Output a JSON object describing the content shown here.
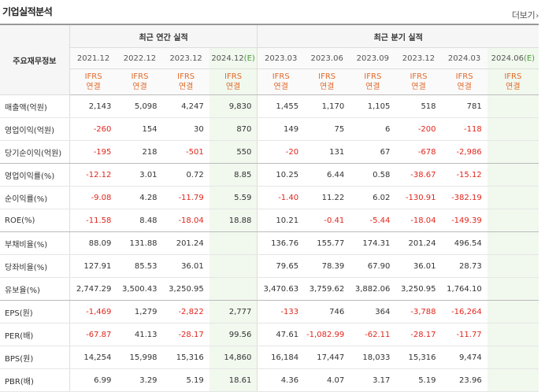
{
  "header": {
    "title": "기업실적분석",
    "more_label": "더보기",
    "more_icon": "chevron-right-icon"
  },
  "table": {
    "label_header": "주요재무정보",
    "groups": {
      "annual": "최근 연간 실적",
      "quarterly": "최근 분기 실적"
    },
    "periods": [
      {
        "label": "2021.12",
        "est": false
      },
      {
        "label": "2022.12",
        "est": false
      },
      {
        "label": "2023.12",
        "est": false
      },
      {
        "label": "2024.12",
        "est": true,
        "mark": "(E)"
      },
      {
        "label": "2023.03",
        "est": false
      },
      {
        "label": "2023.06",
        "est": false
      },
      {
        "label": "2023.09",
        "est": false
      },
      {
        "label": "2023.12",
        "est": false
      },
      {
        "label": "2024.03",
        "est": false
      },
      {
        "label": "2024.06",
        "est": true,
        "mark": "(E)"
      }
    ],
    "report_type": {
      "line1": "IFRS",
      "line2": "연결"
    },
    "rows": [
      {
        "label": "매출액(억원)",
        "values": [
          "2,143",
          "5,098",
          "4,247",
          "9,830",
          "1,455",
          "1,170",
          "1,105",
          "518",
          "781",
          ""
        ]
      },
      {
        "label": "영업이익(억원)",
        "values": [
          "-260",
          "154",
          "30",
          "870",
          "149",
          "75",
          "6",
          "-200",
          "-118",
          ""
        ]
      },
      {
        "label": "당기순이익(억원)",
        "values": [
          "-195",
          "218",
          "-501",
          "550",
          "-20",
          "131",
          "67",
          "-678",
          "-2,986",
          ""
        ]
      },
      {
        "label": "영업이익률(%)",
        "values": [
          "-12.12",
          "3.01",
          "0.72",
          "8.85",
          "10.25",
          "6.44",
          "0.58",
          "-38.67",
          "-15.12",
          ""
        ]
      },
      {
        "label": "순이익률(%)",
        "values": [
          "-9.08",
          "4.28",
          "-11.79",
          "5.59",
          "-1.40",
          "11.22",
          "6.02",
          "-130.91",
          "-382.19",
          ""
        ]
      },
      {
        "label": "ROE(%)",
        "values": [
          "-11.58",
          "8.48",
          "-18.04",
          "18.88",
          "10.21",
          "-0.41",
          "-5.44",
          "-18.04",
          "-149.39",
          ""
        ]
      },
      {
        "label": "부채비율(%)",
        "values": [
          "88.09",
          "131.88",
          "201.24",
          "",
          "136.76",
          "155.77",
          "174.31",
          "201.24",
          "496.54",
          ""
        ]
      },
      {
        "label": "당좌비율(%)",
        "values": [
          "127.91",
          "85.53",
          "36.01",
          "",
          "79.65",
          "78.39",
          "67.90",
          "36.01",
          "28.73",
          ""
        ]
      },
      {
        "label": "유보율(%)",
        "values": [
          "2,747.29",
          "3,500.43",
          "3,250.95",
          "",
          "3,470.63",
          "3,759.62",
          "3,882.06",
          "3,250.95",
          "1,764.10",
          ""
        ]
      },
      {
        "label": "EPS(원)",
        "values": [
          "-1,469",
          "1,279",
          "-2,822",
          "2,777",
          "-133",
          "746",
          "364",
          "-3,788",
          "-16,264",
          ""
        ]
      },
      {
        "label": "PER(배)",
        "values": [
          "-67.87",
          "41.13",
          "-28.17",
          "99.56",
          "47.61",
          "-1,082.99",
          "-62.11",
          "-28.17",
          "-11.77",
          ""
        ]
      },
      {
        "label": "BPS(원)",
        "values": [
          "14,254",
          "15,998",
          "15,316",
          "14,860",
          "16,184",
          "17,447",
          "18,033",
          "15,316",
          "9,474",
          ""
        ]
      },
      {
        "label": "PBR(배)",
        "values": [
          "6.99",
          "3.29",
          "5.19",
          "18.61",
          "4.36",
          "4.07",
          "3.17",
          "5.19",
          "23.96",
          ""
        ]
      }
    ]
  },
  "colors": {
    "negative": "#e0261d",
    "estimate_bg": "#f1f8ee",
    "report_type": "#e06a2c",
    "estimate_mark": "#4b9b3b"
  }
}
